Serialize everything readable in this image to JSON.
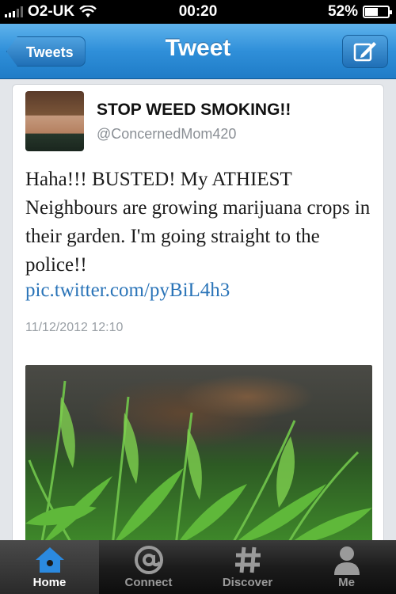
{
  "status": {
    "carrier": "O2-UK",
    "time": "00:20",
    "battery": "52%"
  },
  "nav": {
    "back_label": "Tweets",
    "title": "Tweet",
    "compose_icon": "compose-icon"
  },
  "tweet": {
    "display_name": "STOP WEED SMOKING!!",
    "handle": "@ConcernedMom420",
    "text": "Haha!!! BUSTED! My ATHIEST Neighbours are growing marijuana crops in their garden. I'm going straight to the police!!",
    "link": "pic.twitter.com/pyBiL4h3",
    "timestamp": "11/12/2012 12:10"
  },
  "tabs": [
    {
      "label": "Home",
      "icon": "home-icon",
      "active": true
    },
    {
      "label": "Connect",
      "icon": "at-icon",
      "active": false
    },
    {
      "label": "Discover",
      "icon": "hash-icon",
      "active": false
    },
    {
      "label": "Me",
      "icon": "person-icon",
      "active": false
    }
  ],
  "colors": {
    "nav_blue": "#2f8fd9",
    "link_blue": "#2a74b8",
    "home_icon": "#2b8ae0"
  }
}
